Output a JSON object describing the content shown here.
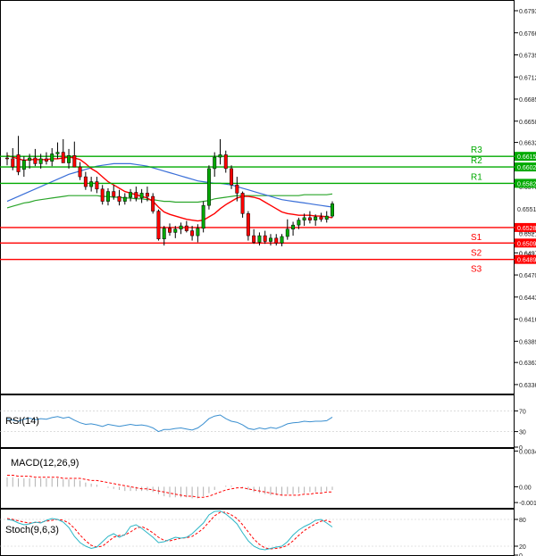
{
  "chart_data": [
    {
      "type": "candlestick",
      "panel": "price",
      "ylim": [
        0.6325,
        0.6805
      ],
      "y_ticks": [
        "0.6793",
        "0.6766",
        "0.6739",
        "0.6712",
        "0.6685",
        "0.6658",
        "0.6632",
        "0.6605",
        "0.6578",
        "0.6551",
        "0.6524",
        "0.6497",
        "0.6470",
        "0.6443",
        "0.6416",
        "0.6389",
        "0.6363",
        "0.6336"
      ],
      "y_tick_values": [
        0.6793,
        0.6766,
        0.6739,
        0.6712,
        0.6685,
        0.6658,
        0.6632,
        0.6605,
        0.6578,
        0.6551,
        0.6524,
        0.6497,
        0.647,
        0.6443,
        0.6416,
        0.6389,
        0.6363,
        0.6336
      ],
      "last_price": "0.6551",
      "candles": [
        [
          0.6613,
          0.662,
          0.6604,
          0.6612
        ],
        [
          0.6612,
          0.6625,
          0.6598,
          0.6602
        ],
        [
          0.6617,
          0.664,
          0.6592,
          0.6596
        ],
        [
          0.6599,
          0.6615,
          0.659,
          0.661
        ],
        [
          0.661,
          0.6618,
          0.66,
          0.6613
        ],
        [
          0.6613,
          0.6624,
          0.6603,
          0.6606
        ],
        [
          0.6606,
          0.6618,
          0.66,
          0.6612
        ],
        [
          0.6612,
          0.662,
          0.6605,
          0.6609
        ],
        [
          0.6609,
          0.6625,
          0.6603,
          0.6618
        ],
        [
          0.6618,
          0.6632,
          0.6612,
          0.662
        ],
        [
          0.662,
          0.6636,
          0.661,
          0.6607
        ],
        [
          0.6607,
          0.6624,
          0.66,
          0.6616
        ],
        [
          0.6616,
          0.6633,
          0.661,
          0.6602
        ],
        [
          0.6602,
          0.6608,
          0.6586,
          0.659
        ],
        [
          0.659,
          0.6596,
          0.6574,
          0.6578
        ],
        [
          0.6578,
          0.659,
          0.6572,
          0.6584
        ],
        [
          0.6584,
          0.659,
          0.657,
          0.6575
        ],
        [
          0.6575,
          0.658,
          0.6556,
          0.656
        ],
        [
          0.656,
          0.6576,
          0.6555,
          0.6572
        ],
        [
          0.6572,
          0.658,
          0.6562,
          0.6566
        ],
        [
          0.6566,
          0.6574,
          0.6555,
          0.656
        ],
        [
          0.656,
          0.657,
          0.6556,
          0.6565
        ],
        [
          0.6565,
          0.6575,
          0.656,
          0.6571
        ],
        [
          0.6571,
          0.6578,
          0.656,
          0.6564
        ],
        [
          0.6564,
          0.6575,
          0.6558,
          0.657
        ],
        [
          0.657,
          0.6578,
          0.656,
          0.6566
        ],
        [
          0.6566,
          0.657,
          0.6545,
          0.6548
        ],
        [
          0.6548,
          0.655,
          0.6512,
          0.6514
        ],
        [
          0.6514,
          0.653,
          0.6506,
          0.6527
        ],
        [
          0.6527,
          0.6533,
          0.6518,
          0.6522
        ],
        [
          0.6522,
          0.653,
          0.6515,
          0.6526
        ],
        [
          0.6526,
          0.6534,
          0.652,
          0.653
        ],
        [
          0.653,
          0.6536,
          0.6522,
          0.6524
        ],
        [
          0.6524,
          0.653,
          0.6512,
          0.6518
        ],
        [
          0.6518,
          0.6532,
          0.651,
          0.6527
        ],
        [
          0.6527,
          0.656,
          0.6522,
          0.6555
        ],
        [
          0.6555,
          0.6604,
          0.655,
          0.66
        ],
        [
          0.66,
          0.662,
          0.659,
          0.6614
        ],
        [
          0.6614,
          0.6636,
          0.6605,
          0.6617
        ],
        [
          0.6617,
          0.6622,
          0.6595,
          0.66
        ],
        [
          0.66,
          0.6604,
          0.6575,
          0.658
        ],
        [
          0.658,
          0.659,
          0.656,
          0.657
        ],
        [
          0.657,
          0.6572,
          0.654,
          0.6545
        ],
        [
          0.6545,
          0.6548,
          0.6512,
          0.6518
        ],
        [
          0.6518,
          0.6526,
          0.6508,
          0.651
        ],
        [
          0.651,
          0.6522,
          0.6506,
          0.6518
        ],
        [
          0.6518,
          0.6524,
          0.6508,
          0.6511
        ],
        [
          0.6511,
          0.652,
          0.6506,
          0.6515
        ],
        [
          0.6515,
          0.652,
          0.6506,
          0.6509
        ],
        [
          0.6509,
          0.652,
          0.6505,
          0.6517
        ],
        [
          0.6517,
          0.6538,
          0.6513,
          0.6526
        ],
        [
          0.6526,
          0.6535,
          0.6518,
          0.6531
        ],
        [
          0.6531,
          0.654,
          0.6526,
          0.6537
        ],
        [
          0.6537,
          0.6545,
          0.653,
          0.654
        ],
        [
          0.654,
          0.6548,
          0.6533,
          0.6537
        ],
        [
          0.6537,
          0.6544,
          0.653,
          0.6541
        ],
        [
          0.6541,
          0.6546,
          0.6535,
          0.6538
        ],
        [
          0.6538,
          0.6548,
          0.6534,
          0.6542
        ],
        [
          0.6542,
          0.656,
          0.654,
          0.6557
        ]
      ],
      "sma_red": [
        0.6616,
        0.6614,
        0.6612,
        0.661,
        0.6611,
        0.6611,
        0.6611,
        0.6611,
        0.6612,
        0.6612,
        0.6613,
        0.6614,
        0.6613,
        0.6611,
        0.6606,
        0.66,
        0.6596,
        0.659,
        0.6584,
        0.658,
        0.6576,
        0.6572,
        0.657,
        0.6568,
        0.6566,
        0.6564,
        0.656,
        0.6553,
        0.6547,
        0.6544,
        0.6542,
        0.654,
        0.6538,
        0.6537,
        0.6536,
        0.6537,
        0.6541,
        0.6545,
        0.6551,
        0.6556,
        0.656,
        0.6564,
        0.6566,
        0.6566,
        0.6565,
        0.6563,
        0.6559,
        0.6555,
        0.6551,
        0.6547,
        0.6545,
        0.6544,
        0.6543,
        0.6543,
        0.6543,
        0.6542,
        0.6542,
        0.6541,
        0.654
      ],
      "sma_blue": [
        0.656,
        0.6563,
        0.6566,
        0.6569,
        0.6572,
        0.6575,
        0.6578,
        0.6581,
        0.6584,
        0.6587,
        0.659,
        0.6593,
        0.6595,
        0.6597,
        0.6599,
        0.6601,
        0.6603,
        0.6604,
        0.6605,
        0.6606,
        0.6606,
        0.6606,
        0.6606,
        0.6605,
        0.6604,
        0.6603,
        0.6601,
        0.6599,
        0.6597,
        0.6595,
        0.6593,
        0.6591,
        0.6589,
        0.6587,
        0.6585,
        0.6584,
        0.6583,
        0.6582,
        0.6582,
        0.6581,
        0.658,
        0.6578,
        0.6576,
        0.6574,
        0.6572,
        0.657,
        0.6568,
        0.6566,
        0.6564,
        0.6562,
        0.6561,
        0.656,
        0.6559,
        0.6558,
        0.6557,
        0.6556,
        0.6555,
        0.6554,
        0.6553
      ],
      "sma_green": [
        0.6552,
        0.6554,
        0.6556,
        0.6558,
        0.6559,
        0.6561,
        0.6562,
        0.6563,
        0.6564,
        0.6565,
        0.6566,
        0.6567,
        0.6567,
        0.6567,
        0.6567,
        0.6567,
        0.6567,
        0.6566,
        0.6566,
        0.6565,
        0.6565,
        0.6564,
        0.6564,
        0.6563,
        0.6563,
        0.6562,
        0.6562,
        0.6561,
        0.656,
        0.656,
        0.6559,
        0.6559,
        0.6559,
        0.6559,
        0.6559,
        0.656,
        0.6561,
        0.6563,
        0.6564,
        0.6565,
        0.6566,
        0.6567,
        0.6567,
        0.6567,
        0.6567,
        0.6567,
        0.6567,
        0.6567,
        0.6567,
        0.6567,
        0.6567,
        0.6567,
        0.6567,
        0.6568,
        0.6568,
        0.6568,
        0.6568,
        0.6568,
        0.6569
      ],
      "levels": [
        {
          "name": "R3",
          "value": 0.6615,
          "label": "0.6615",
          "color": "#00aa00"
        },
        {
          "name": "R2",
          "value": 0.6602,
          "label": "0.6602",
          "color": "#00aa00"
        },
        {
          "name": "R1",
          "value": 0.6582,
          "label": "0.6582",
          "color": "#00aa00"
        },
        {
          "name": "S1",
          "value": 0.6528,
          "label": "0.6528",
          "color": "#ff0000"
        },
        {
          "name": "S2",
          "value": 0.6509,
          "label": "0.6509",
          "color": "#ff0000"
        },
        {
          "name": "S3",
          "value": 0.6489,
          "label": "0.6489",
          "color": "#ff0000"
        }
      ],
      "extra_axis_labels": [
        "0.6521",
        "0.6497"
      ],
      "colors": {
        "bull": "#00aa00",
        "bear": "#ff0000",
        "sma_red": "#ff0000",
        "sma_blue": "#3a6fd8",
        "sma_green": "#2aa52a"
      }
    },
    {
      "type": "line",
      "panel": "rsi",
      "title": "RSI(14)",
      "ylim": [
        0,
        100
      ],
      "y_ticks": [
        "70",
        "30",
        "0"
      ],
      "y_tick_values": [
        70,
        30,
        0
      ],
      "values": [
        55,
        52,
        50,
        54,
        56,
        53,
        55,
        54,
        57,
        59,
        56,
        58,
        52,
        47,
        44,
        45,
        43,
        40,
        44,
        42,
        40,
        42,
        44,
        42,
        43,
        41,
        37,
        30,
        34,
        34,
        36,
        37,
        35,
        33,
        37,
        45,
        55,
        60,
        62,
        55,
        50,
        48,
        43,
        36,
        34,
        37,
        35,
        38,
        36,
        40,
        45,
        47,
        48,
        50,
        49,
        50,
        50,
        51,
        58
      ],
      "color": "#3a8fd0"
    },
    {
      "type": "bar",
      "panel": "macd",
      "title": "MACD(12,26,9)",
      "ylim": [
        -0.002,
        0.0036
      ],
      "y_ticks": [
        "0.0034",
        "0.00",
        "-0.0015"
      ],
      "y_tick_values": [
        0.0034,
        0.0,
        -0.0015
      ],
      "histogram": [
        0.0009,
        0.0009,
        0.0008,
        0.0008,
        0.0008,
        0.0008,
        0.0008,
        0.0008,
        0.0008,
        0.0008,
        0.0007,
        0.0007,
        0.0007,
        0.0006,
        0.0004,
        0.0003,
        0.0002,
        0.0,
        -0.0001,
        -0.0002,
        -0.0003,
        -0.0004,
        -0.0004,
        -0.0004,
        -0.0004,
        -0.0004,
        -0.0005,
        -0.0007,
        -0.0009,
        -0.001,
        -0.001,
        -0.001,
        -0.001,
        -0.0011,
        -0.0011,
        -0.0009,
        -0.0006,
        -0.0003,
        0.0,
        0.0001,
        0.0001,
        0.0,
        -0.0001,
        -0.0003,
        -0.0005,
        -0.0006,
        -0.0007,
        -0.0008,
        -0.0008,
        -0.0008,
        -0.0007,
        -0.0007,
        -0.0006,
        -0.0006,
        -0.0005,
        -0.0005,
        -0.0005,
        -0.0004,
        -0.0003
      ],
      "signal": [
        0.0011,
        0.0011,
        0.001,
        0.001,
        0.001,
        0.0009,
        0.0009,
        0.0009,
        0.0009,
        0.0009,
        0.0008,
        0.0008,
        0.0008,
        0.0008,
        0.0007,
        0.0006,
        0.0006,
        0.0005,
        0.0004,
        0.0003,
        0.0002,
        0.0001,
        0.0,
        -0.0001,
        -0.0002,
        -0.0002,
        -0.0003,
        -0.0004,
        -0.0005,
        -0.0006,
        -0.0007,
        -0.0008,
        -0.0009,
        -0.0009,
        -0.001,
        -0.001,
        -0.0009,
        -0.0007,
        -0.0005,
        -0.0003,
        -0.0002,
        -0.0001,
        -0.0001,
        -0.0002,
        -0.0003,
        -0.0004,
        -0.0005,
        -0.0006,
        -0.0007,
        -0.0008,
        -0.0008,
        -0.0008,
        -0.0008,
        -0.0007,
        -0.0007,
        -0.0006,
        -0.0006,
        -0.0005,
        -0.0005
      ],
      "bar_color": "#b0b0b0",
      "signal_color": "#ff0000"
    },
    {
      "type": "line",
      "panel": "stoch",
      "title": "Stoch(9,6,3)",
      "ylim": [
        0,
        100
      ],
      "y_ticks": [
        "80",
        "20",
        "0"
      ],
      "y_tick_values": [
        80,
        20,
        0
      ],
      "k": [
        80,
        78,
        72,
        68,
        70,
        74,
        72,
        78,
        82,
        80,
        74,
        62,
        42,
        28,
        20,
        15,
        18,
        30,
        42,
        48,
        40,
        46,
        64,
        68,
        60,
        50,
        40,
        28,
        30,
        35,
        40,
        38,
        40,
        48,
        60,
        72,
        90,
        98,
        99,
        92,
        82,
        70,
        50,
        32,
        20,
        14,
        12,
        15,
        18,
        20,
        30,
        45,
        56,
        64,
        70,
        78,
        80,
        72,
        63
      ],
      "d": [
        82,
        80,
        77,
        74,
        72,
        73,
        74,
        76,
        78,
        80,
        78,
        72,
        60,
        45,
        32,
        22,
        18,
        20,
        30,
        40,
        44,
        45,
        52,
        60,
        64,
        58,
        50,
        40,
        33,
        32,
        35,
        38,
        39,
        42,
        50,
        60,
        74,
        88,
        96,
        96,
        90,
        82,
        68,
        52,
        36,
        24,
        16,
        14,
        15,
        17,
        22,
        32,
        44,
        55,
        63,
        70,
        76,
        78,
        72
      ],
      "k_color": "#2cb6c6",
      "d_color": "#ff0000"
    }
  ]
}
